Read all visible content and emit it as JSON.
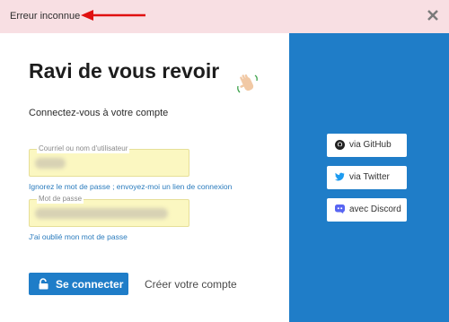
{
  "error": {
    "message": "Erreur inconnue"
  },
  "login": {
    "title": "Ravi de vous revoir",
    "subtitle": "Connectez-vous à votre compte",
    "username_label": "Courriel ou nom d'utilisateur",
    "email_link": "Ignorez le mot de passe ; envoyez-moi un lien de connexion",
    "password_label": "Mot de passe",
    "forgot_link": "J'ai oublié mon mot de passe",
    "submit": "Se connecter",
    "signup": "Créer votre compte"
  },
  "social": {
    "github": "via GitHub",
    "twitter": "via Twitter",
    "discord": "avec Discord"
  },
  "colors": {
    "brand": "#1f7dc8",
    "error_bg": "#f8dfe3",
    "arrow": "#e01010",
    "field_bg": "#fbf7c1"
  }
}
